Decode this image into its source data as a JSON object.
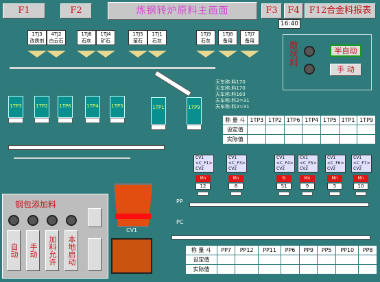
{
  "header": {
    "title": "炼钢转炉原料主画面",
    "f1": "F1",
    "f2": "F2",
    "f3": "F3",
    "f4": "F4",
    "f12": "F12合金料报表",
    "time": "16:40"
  },
  "bins_top": [
    {
      "id": "1TJ3",
      "name": "改质剂"
    },
    {
      "id": "4TJ2",
      "name": "白云石"
    },
    {
      "id": "1TJ6",
      "name": "石灰"
    },
    {
      "id": "1TJ4",
      "name": "矿石"
    },
    {
      "id": "1TJ5",
      "name": "萤石"
    },
    {
      "id": "1TJ1",
      "name": "石灰"
    },
    {
      "id": "1TJ9",
      "name": "石灰"
    },
    {
      "id": "1TJ8",
      "name": "备用"
    },
    {
      "id": "1TJ7",
      "name": "备用"
    }
  ],
  "silos": [
    "1TP3",
    "1TP2",
    "1TP6",
    "1TP4",
    "1TP5",
    "1TP1",
    "1TP9"
  ],
  "stats": [
    "天车称:料170",
    "天车称:料170",
    "天车称:料160",
    "天车称:料2=31",
    "天车称:料2=31"
  ],
  "scatter": {
    "label": "散状料",
    "btn_semi": "半自动",
    "btn_manual": "手  动"
  },
  "table1": {
    "row_label": "称 量 斗",
    "set_label": "设定值",
    "act_label": "实际值",
    "cols": [
      "1TP3",
      "1TP2",
      "1TP6",
      "1TP4",
      "1TP5",
      "1TP1",
      "1TP9"
    ]
  },
  "cv_units": [
    {
      "cv1": "CV1",
      "mid": "<C_F1>",
      "cv2": "CV2",
      "mn": "Mn",
      "val": "12"
    },
    {
      "cv1": "CV1",
      "mid": "<C_F3>",
      "cv2": "CV2",
      "mn": "Mn",
      "val": "8"
    },
    {
      "cv1": "CV1",
      "mid": "<C_F4>",
      "cv2": "CV2",
      "mn": "Si",
      "val": "S1"
    },
    {
      "cv1": "CV1",
      "mid": "<C_F5>",
      "cv2": "CV2",
      "mn": "Mn",
      "val": "9"
    },
    {
      "cv1": "CV1",
      "mid": "<C_F6>",
      "cv2": "CV2",
      "mn": "Mn",
      "val": "5"
    },
    {
      "cv1": "CV1",
      "mid": "<C_F7>",
      "cv2": "CV2",
      "mn": "Mn",
      "val": "10"
    }
  ],
  "ladle": {
    "title": "钢包添加料",
    "b1": "自动",
    "b2": "手动",
    "b3": "加料允许",
    "b4": "本地启动",
    "cv": "CV1",
    "pp": "PP",
    "pc": "PC"
  },
  "table2": {
    "row_label": "称 量 斗",
    "set_label": "设定值",
    "act_label": "实际值",
    "cols": [
      "PP7",
      "PP12",
      "PP11",
      "PP6",
      "PP9",
      "PP5",
      "PP10",
      "PP8"
    ]
  },
  "colors": {
    "bg": "#2f7a7a",
    "accent": "#c0161b",
    "title": "#d44bd1"
  }
}
